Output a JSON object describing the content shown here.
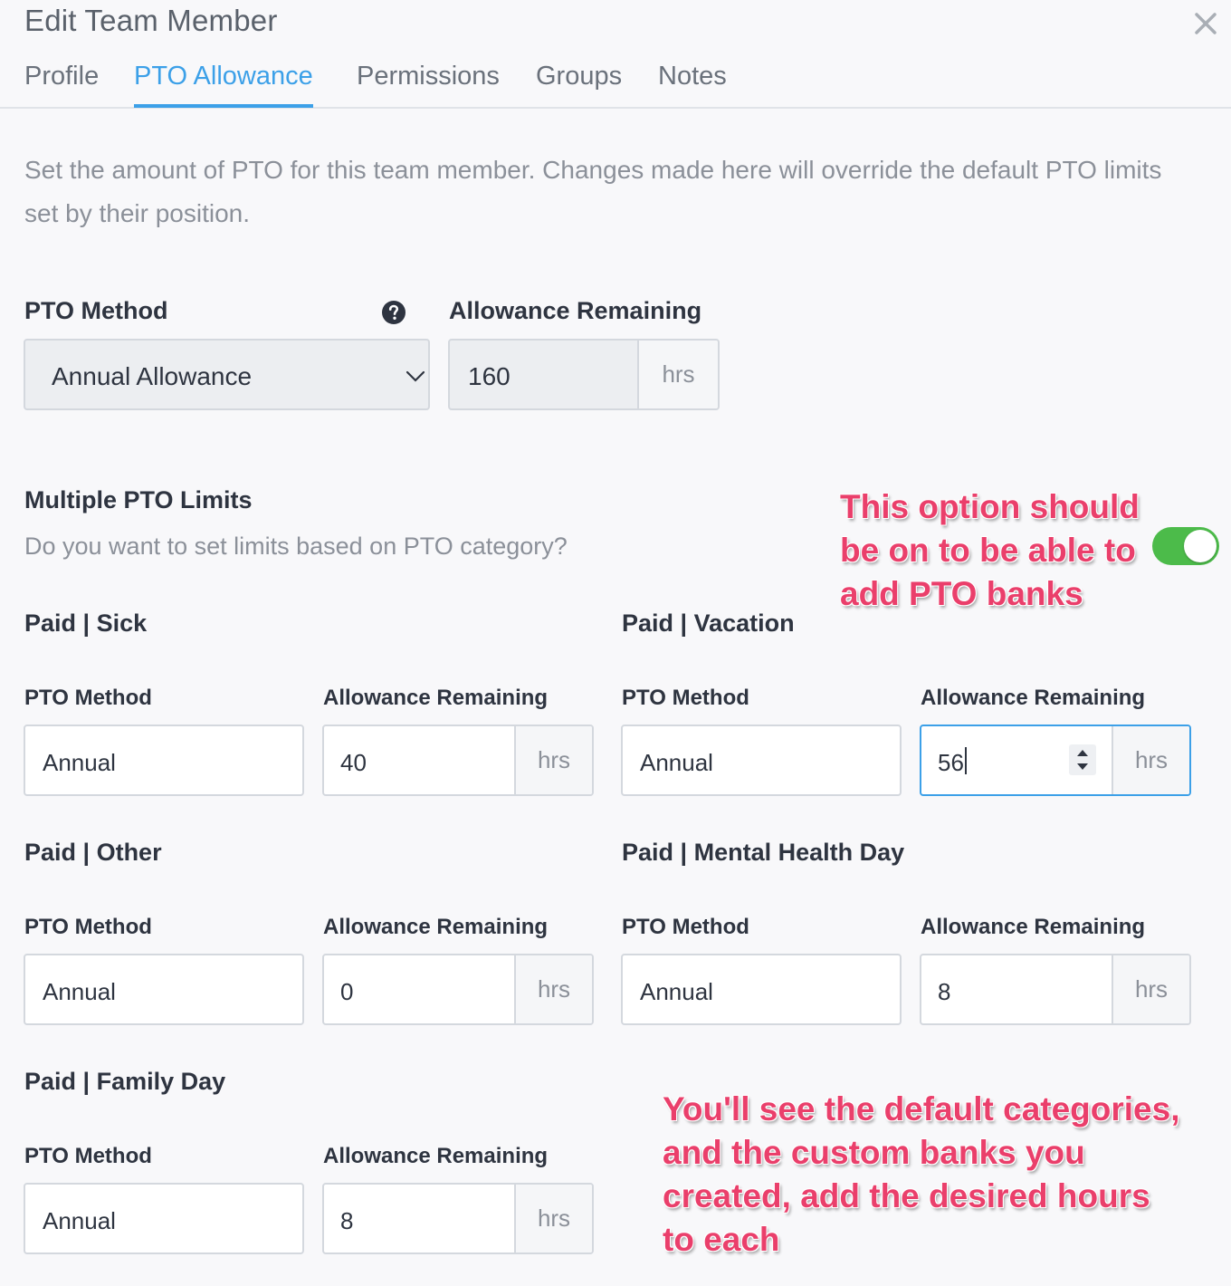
{
  "header": {
    "title": "Edit Team Member"
  },
  "tabs": [
    {
      "label": "Profile"
    },
    {
      "label": "PTO Allowance"
    },
    {
      "label": "Permissions"
    },
    {
      "label": "Groups"
    },
    {
      "label": "Notes"
    }
  ],
  "intro": "Set the amount of PTO for this team member. Changes made here will override the default PTO limits set by their position.",
  "main_pto": {
    "method_label": "PTO Method",
    "method_value": "Annual Allowance",
    "allowance_label": "Allowance Remaining",
    "allowance_value": "160",
    "unit": "hrs"
  },
  "multiple_limits": {
    "title": "Multiple PTO Limits",
    "question": "Do you want to set limits based on PTO category?",
    "enabled": true
  },
  "categories": [
    {
      "title": "Paid | Sick",
      "method_label": "PTO Method",
      "method_value": "Annual",
      "allowance_label": "Allowance Remaining",
      "allowance_value": "40",
      "unit": "hrs"
    },
    {
      "title": "Paid | Vacation",
      "method_label": "PTO Method",
      "method_value": "Annual",
      "allowance_label": "Allowance Remaining",
      "allowance_value": "56",
      "unit": "hrs"
    },
    {
      "title": "Paid | Other",
      "method_label": "PTO Method",
      "method_value": "Annual",
      "allowance_label": "Allowance Remaining",
      "allowance_value": "0",
      "unit": "hrs"
    },
    {
      "title": "Paid | Mental Health Day",
      "method_label": "PTO Method",
      "method_value": "Annual",
      "allowance_label": "Allowance Remaining",
      "allowance_value": "8",
      "unit": "hrs"
    },
    {
      "title": "Paid | Family Day",
      "method_label": "PTO Method",
      "method_value": "Annual",
      "allowance_label": "Allowance Remaining",
      "allowance_value": "8",
      "unit": "hrs"
    }
  ],
  "annotations": {
    "toggle_note": [
      "This option should",
      "be on to be able to",
      "add PTO banks"
    ],
    "banks_note": [
      "You'll see the default categories,",
      "and the custom banks you",
      "created, add the desired hours",
      "to each"
    ]
  },
  "colors": {
    "accent": "#3ca0e8",
    "toggle_on": "#4cbb4a",
    "annotation": "#ea3f6b"
  }
}
